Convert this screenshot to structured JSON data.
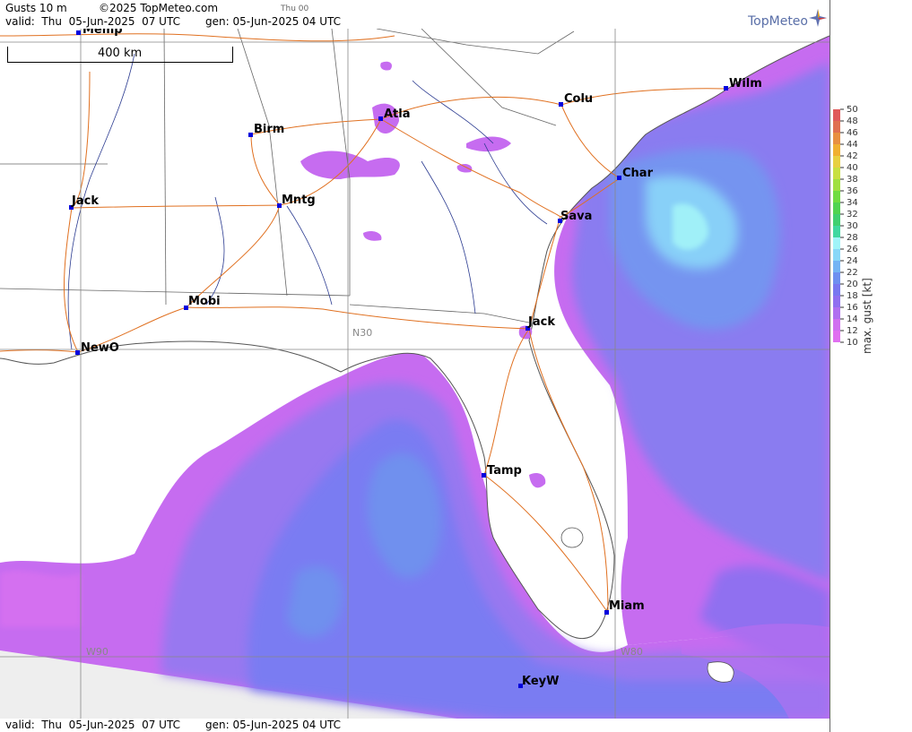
{
  "header": {
    "product": "Gusts 10 m",
    "copyright": "©2025 TopMeteo.com",
    "run_tag": "Thu 00",
    "valid": "valid:  Thu  05-Jun-2025  07 UTC",
    "generated": "gen: 05-Jun-2025 04 UTC"
  },
  "footer": {
    "valid": "valid:  Thu  05-Jun-2025  07 UTC",
    "generated": "gen: 05-Jun-2025 04 UTC"
  },
  "logo": {
    "text": "TopMeteo",
    "color": "#5a6fa8"
  },
  "scale": {
    "label": "400 km"
  },
  "map": {
    "grid_labels": [
      "N30",
      "W90",
      "W80"
    ],
    "cities": [
      {
        "name": "Memp",
        "label": "Memp"
      },
      {
        "name": "Birm",
        "label": "Birm"
      },
      {
        "name": "Atla",
        "label": "Atla"
      },
      {
        "name": "Colu",
        "label": "Colu"
      },
      {
        "name": "Wilm",
        "label": "Wilm"
      },
      {
        "name": "Char",
        "label": "Char"
      },
      {
        "name": "Sava",
        "label": "Sava"
      },
      {
        "name": "Jack-ms",
        "label": "Jack"
      },
      {
        "name": "Mntg",
        "label": "Mntg"
      },
      {
        "name": "Mobi",
        "label": "Mobi"
      },
      {
        "name": "NewO",
        "label": "NewO"
      },
      {
        "name": "Jack-fl",
        "label": "Jack"
      },
      {
        "name": "Tamp",
        "label": "Tamp"
      },
      {
        "name": "Miam",
        "label": "Miam"
      },
      {
        "name": "KeyW",
        "label": "KeyW"
      }
    ]
  },
  "legend": {
    "title": "max. gust [kt]",
    "ticks": [
      "50",
      "48",
      "46",
      "44",
      "42",
      "40",
      "38",
      "36",
      "34",
      "32",
      "30",
      "28",
      "26",
      "24",
      "22",
      "20",
      "18",
      "16",
      "14",
      "12",
      "10"
    ],
    "colors": [
      "#e05a5a",
      "#e07050",
      "#e89040",
      "#f0b030",
      "#e8d040",
      "#c8e040",
      "#a0e040",
      "#70dc40",
      "#50d450",
      "#40d070",
      "#40d8a0",
      "#a0f4f8",
      "#88d8f8",
      "#74b4f4",
      "#6e90f0",
      "#7878f0",
      "#9070f0",
      "#b070f0",
      "#d070f0",
      "#e070f0"
    ]
  }
}
